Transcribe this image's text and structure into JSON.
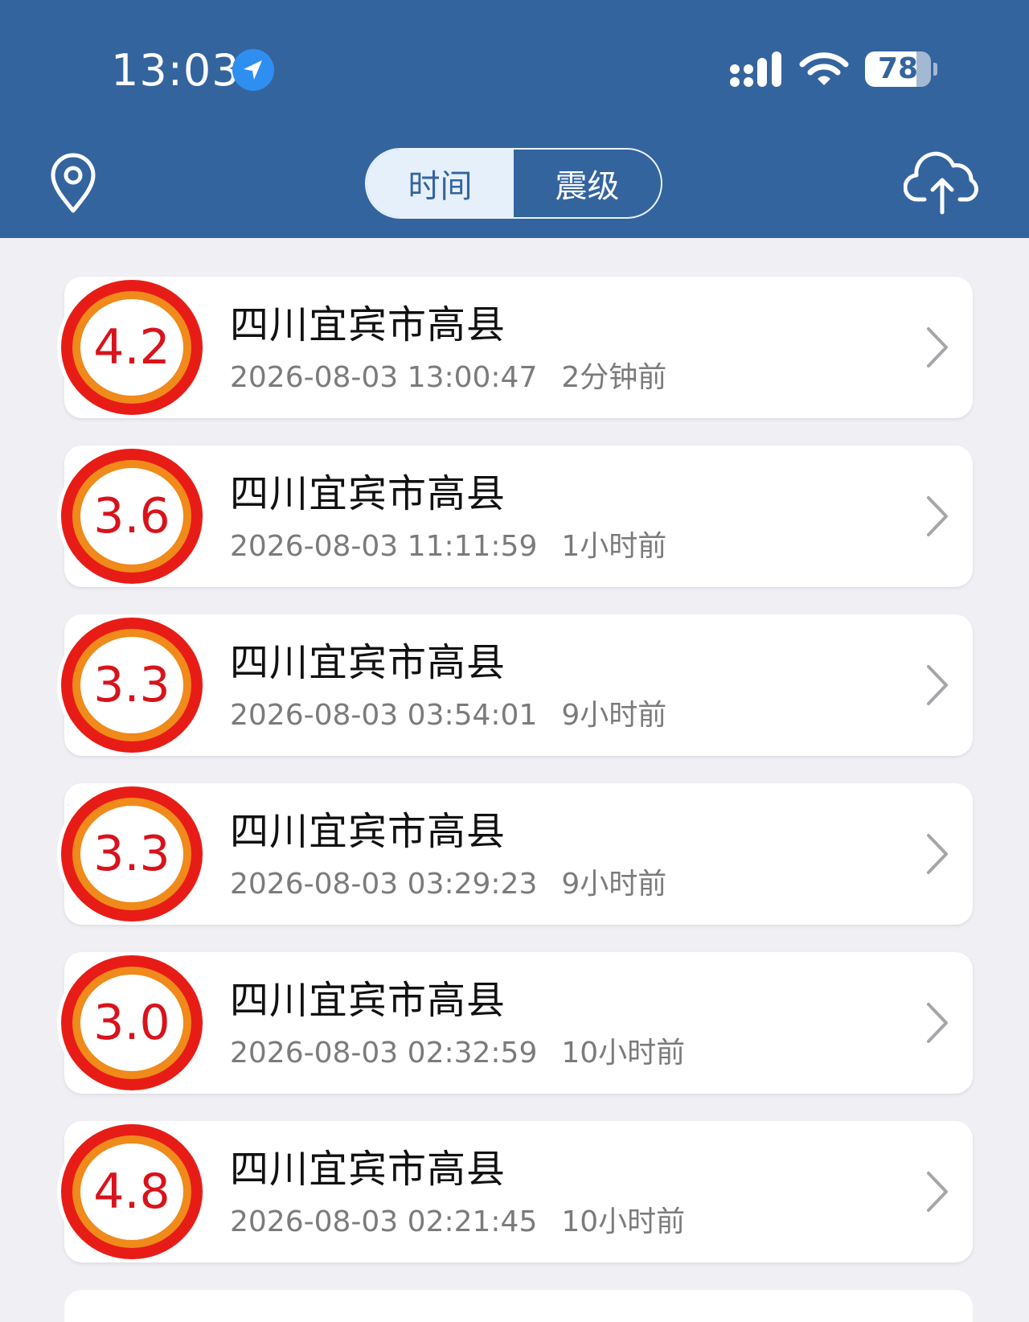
{
  "status_bar": {
    "time": "13:03",
    "battery": "78",
    "battery_level": 0.78
  },
  "header": {
    "tabs": [
      {
        "label": "时间",
        "active": true
      },
      {
        "label": "震级",
        "active": false
      }
    ],
    "left_icon": "location-pin-icon",
    "right_icon": "cloud-upload-icon"
  },
  "colors": {
    "header_bg": "#34649e",
    "page_bg": "#efeff4",
    "badge_red": "#e81c16",
    "badge_orange": "#f08a1a",
    "magnitude_text": "#d8131b"
  },
  "quakes": [
    {
      "magnitude": "4.2",
      "place": "四川宜宾市高县",
      "datetime": "2026-08-03 13:00:47",
      "ago": "2分钟前"
    },
    {
      "magnitude": "3.6",
      "place": "四川宜宾市高县",
      "datetime": "2026-08-03 11:11:59",
      "ago": "1小时前"
    },
    {
      "magnitude": "3.3",
      "place": "四川宜宾市高县",
      "datetime": "2026-08-03 03:54:01",
      "ago": "9小时前"
    },
    {
      "magnitude": "3.3",
      "place": "四川宜宾市高县",
      "datetime": "2026-08-03 03:29:23",
      "ago": "9小时前"
    },
    {
      "magnitude": "3.0",
      "place": "四川宜宾市高县",
      "datetime": "2026-08-03 02:32:59",
      "ago": "10小时前"
    },
    {
      "magnitude": "4.8",
      "place": "四川宜宾市高县",
      "datetime": "2026-08-03 02:21:45",
      "ago": "10小时前"
    }
  ]
}
